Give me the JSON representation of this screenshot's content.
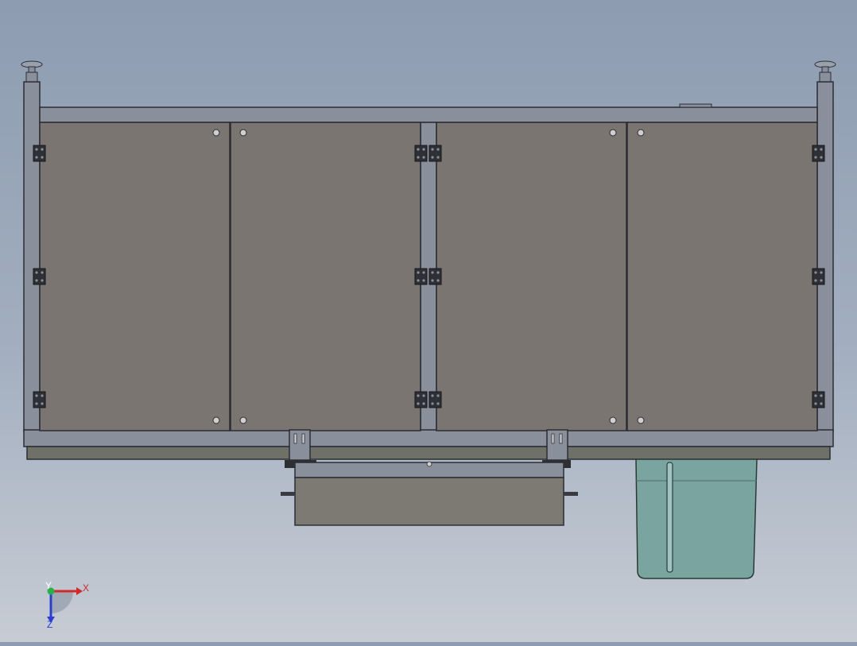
{
  "viewport": {
    "background_top": "#8d9cb1",
    "background_bottom": "#c7ccd4"
  },
  "model": {
    "frame_color": "#8a8f9c",
    "frame_edge_color": "#2b2d33",
    "panel_color": "#7a7570",
    "bin_color": "#79a4a0",
    "drawer_color": "#7d7a73"
  },
  "triad": {
    "x_label": "X",
    "y_label": "Y",
    "z_label": "Z",
    "x_color": "#d12a2a",
    "y_color": "#28b04a",
    "z_color": "#2a3fd1"
  }
}
